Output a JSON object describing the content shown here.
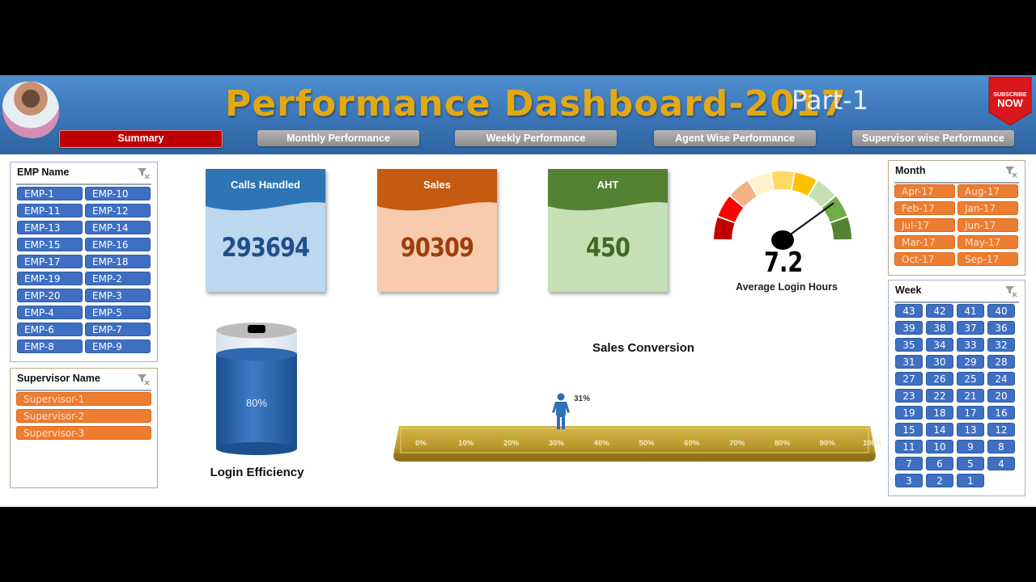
{
  "header": {
    "title": "Performance Dashboard-2017",
    "part": "Part-1",
    "subscribe_top": "SUBSCRIBE",
    "subscribe_bottom": "NOW"
  },
  "nav": [
    {
      "label": "Summary",
      "active": true
    },
    {
      "label": "Monthly Performance",
      "active": false
    },
    {
      "label": "Weekly Performance",
      "active": false
    },
    {
      "label": "Agent Wise Performance",
      "active": false
    },
    {
      "label": "Supervisor wise Performance",
      "active": false
    }
  ],
  "slicers": {
    "emp": {
      "title": "EMP Name",
      "items": [
        "EMP-1",
        "EMP-10",
        "EMP-11",
        "EMP-12",
        "EMP-13",
        "EMP-14",
        "EMP-15",
        "EMP-16",
        "EMP-17",
        "EMP-18",
        "EMP-19",
        "EMP-2",
        "EMP-20",
        "EMP-3",
        "EMP-4",
        "EMP-5",
        "EMP-6",
        "EMP-7",
        "EMP-8",
        "EMP-9"
      ]
    },
    "supervisor": {
      "title": "Supervisor Name",
      "items": [
        "Supervisor-1",
        "Supervisor-2",
        "Supervisor-3"
      ]
    },
    "month": {
      "title": "Month",
      "items": [
        "Apr-17",
        "Aug-17",
        "Feb-17",
        "Jan-17",
        "Jul-17",
        "Jun-17",
        "Mar-17",
        "May-17",
        "Oct-17",
        "Sep-17"
      ]
    },
    "week": {
      "title": "Week",
      "items": [
        "43",
        "42",
        "41",
        "40",
        "39",
        "38",
        "37",
        "36",
        "35",
        "34",
        "33",
        "32",
        "31",
        "30",
        "29",
        "28",
        "27",
        "26",
        "25",
        "24",
        "23",
        "22",
        "21",
        "20",
        "19",
        "18",
        "17",
        "16",
        "15",
        "14",
        "13",
        "12",
        "11",
        "10",
        "9",
        "8",
        "7",
        "6",
        "5",
        "4",
        "3",
        "2",
        "1"
      ]
    }
  },
  "kpis": {
    "calls": {
      "label": "Calls Handled",
      "value": "293694",
      "head": "#2e75b6",
      "body": "#bdd7ee",
      "text": "#1f4e8c"
    },
    "sales": {
      "label": "Sales",
      "value": "90309",
      "head": "#c55a11",
      "body": "#f8cbad",
      "text": "#9c3f0a"
    },
    "aht": {
      "label": "AHT",
      "value": "450",
      "head": "#548235",
      "body": "#c5e0b4",
      "text": "#3f6b25"
    }
  },
  "gauge": {
    "value": "7.2",
    "label": "Average Login Hours",
    "fraction": 0.8,
    "colors": [
      "#c00000",
      "#ff0000",
      "#f4b183",
      "#fff2cc",
      "#ffd966",
      "#ffc000",
      "#c5e0b4",
      "#70ad47",
      "#548235"
    ]
  },
  "login_efficiency": {
    "value": "80%",
    "fraction": 0.8,
    "label": "Login Efficiency"
  },
  "sales_conversion": {
    "title": "Sales Conversion",
    "value": "31%",
    "fraction": 0.31,
    "ticks": [
      "0%",
      "10%",
      "20%",
      "30%",
      "40%",
      "50%",
      "60%",
      "70%",
      "80%",
      "90%",
      "100%"
    ]
  }
}
